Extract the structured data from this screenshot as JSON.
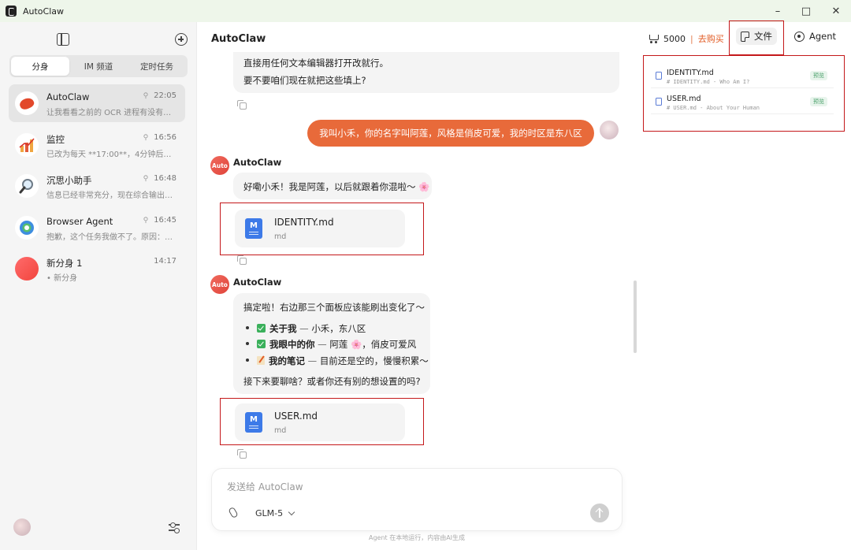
{
  "window": {
    "title": "AutoClaw",
    "minimize": "–",
    "maximize": "□",
    "close": "✕"
  },
  "sidebar": {
    "tabs": [
      {
        "label": "分身",
        "active": true
      },
      {
        "label": "IM 频道",
        "active": false
      },
      {
        "label": "定时任务",
        "active": false
      }
    ],
    "sessions": [
      {
        "name": "AutoClaw",
        "time": "22:05",
        "pinned": true,
        "preview": "让我看看之前的 OCR 进程有没有产...",
        "active": true,
        "avatar": "lobster-icon"
      },
      {
        "name": "监控",
        "time": "16:56",
        "pinned": true,
        "preview": "已改为每天 **17:00**，4分钟后（今...",
        "active": false,
        "avatar": "chart-icon"
      },
      {
        "name": "沉思小助手",
        "time": "16:48",
        "pinned": true,
        "preview": "信息已经非常充分，现在综合输出深...",
        "active": false,
        "avatar": "magnifier-icon"
      },
      {
        "name": "Browser Agent",
        "time": "16:45",
        "pinned": true,
        "preview": "抱歉，这个任务我做不了。原因：1. ...",
        "active": false,
        "avatar": "browser-icon"
      },
      {
        "name": "新分身 1",
        "time": "14:17",
        "pinned": false,
        "preview": "• 新分身",
        "active": false,
        "avatar": "new-agent-icon"
      }
    ]
  },
  "header": {
    "title": "AutoClaw",
    "credits": "5000",
    "separator": "|",
    "buy_label": "去购买",
    "files_label": "文件",
    "agent_label": "Agent"
  },
  "files_panel": {
    "files": [
      {
        "name": "IDENTITY.md",
        "desc": "# IDENTITY.md - Who Am I?",
        "tag": "预览"
      },
      {
        "name": "USER.md",
        "desc": "# USER.md - About Your Human",
        "tag": "预览"
      }
    ]
  },
  "chat": {
    "msg0": {
      "line1": "直接用任何文本编辑器打开改就行。",
      "line2": "要不要咱们现在就把这些填上?"
    },
    "user_msg": "我叫小禾，你的名字叫阿莲，风格是俏皮可爱，我的时区是东八区",
    "agent_label": "Auto",
    "agent_name": "AutoClaw",
    "msg1": {
      "text": "好嘞小禾！我是阿莲，以后就跟着你混啦～",
      "emoji": "🌸"
    },
    "file1": {
      "name": "IDENTITY.md",
      "ext": "md",
      "icon": "M"
    },
    "msg2": {
      "intro": "搞定啦！右边那三个面板应该能刷出变化了～",
      "items": [
        {
          "title": "关于我",
          "dash": "—",
          "rest": "小禾，东八区"
        },
        {
          "title": "我眼中的你",
          "dash": "—",
          "rest": "阿莲",
          "rest2": "，俏皮可爱风"
        },
        {
          "title": "我的笔记",
          "dash": "—",
          "rest": "目前还是空的，慢慢积累～"
        }
      ],
      "outro": "接下来要聊啥？或者你还有别的想设置的吗?"
    },
    "file2": {
      "name": "USER.md",
      "ext": "md",
      "icon": "M"
    }
  },
  "composer": {
    "placeholder": "发送给 AutoClaw",
    "model": "GLM-5",
    "footer": "Agent 在本地运行，内容由AI生成"
  },
  "colors": {
    "accent": "#e86a3a",
    "buy": "#e25b24",
    "highlight_box": "#c4181a",
    "file_icon": "#3d7ae8"
  }
}
